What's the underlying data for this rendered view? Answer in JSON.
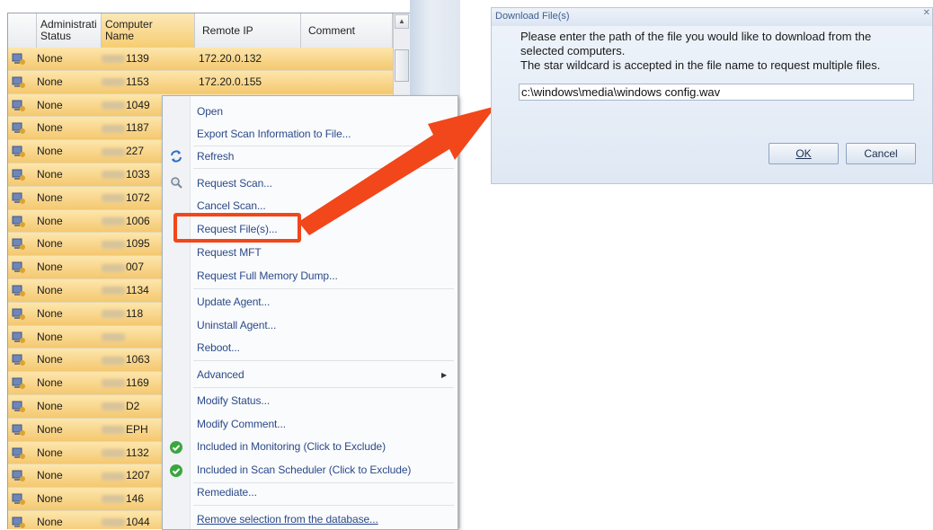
{
  "grid": {
    "headers": {
      "admin_status": "Administrati\nStatus",
      "computer_name": "Computer\nName",
      "remote_ip": "Remote IP",
      "comment": "Comment"
    },
    "rows": [
      {
        "status": "None",
        "name": "1139",
        "ip": "172.20.0.132"
      },
      {
        "status": "None",
        "name": "1153",
        "ip": "172.20.0.155"
      },
      {
        "status": "None",
        "name": "1049",
        "ip": ""
      },
      {
        "status": "None",
        "name": "1187",
        "ip": ""
      },
      {
        "status": "None",
        "name": "227",
        "ip": ""
      },
      {
        "status": "None",
        "name": "1033",
        "ip": ""
      },
      {
        "status": "None",
        "name": "1072",
        "ip": ""
      },
      {
        "status": "None",
        "name": "1006",
        "ip": ""
      },
      {
        "status": "None",
        "name": "1095",
        "ip": ""
      },
      {
        "status": "None",
        "name": "007",
        "ip": ""
      },
      {
        "status": "None",
        "name": "1134",
        "ip": ""
      },
      {
        "status": "None",
        "name": "118",
        "ip": ""
      },
      {
        "status": "None",
        "name": "",
        "ip": ""
      },
      {
        "status": "None",
        "name": "1063",
        "ip": ""
      },
      {
        "status": "None",
        "name": "1169",
        "ip": ""
      },
      {
        "status": "None",
        "name": "D2",
        "ip": ""
      },
      {
        "status": "None",
        "name": "EPH",
        "ip": ""
      },
      {
        "status": "None",
        "name": "1132",
        "ip": ""
      },
      {
        "status": "None",
        "name": "1207",
        "ip": ""
      },
      {
        "status": "None",
        "name": "146",
        "ip": ""
      },
      {
        "status": "None",
        "name": "1044",
        "ip": ""
      }
    ]
  },
  "context_menu": {
    "open": "Open",
    "export": "Export Scan Information to File...",
    "refresh": "Refresh",
    "request_scan": "Request Scan...",
    "cancel_scan": "Cancel Scan...",
    "request_files": "Request File(s)...",
    "request_mft": "Request MFT",
    "request_memory": "Request Full Memory Dump...",
    "update_agent": "Update Agent...",
    "uninstall_agent": "Uninstall Agent...",
    "reboot": "Reboot...",
    "advanced": "Advanced",
    "modify_status": "Modify Status...",
    "modify_comment": "Modify Comment...",
    "included_monitoring": "Included in Monitoring (Click to Exclude)",
    "included_scheduler": "Included in Scan Scheduler (Click to Exclude)",
    "remediate": "Remediate...",
    "remove_selection": "Remove selection from the database..."
  },
  "dialog": {
    "title": "Download File(s)",
    "message_line1": "Please enter the path of the file you would like to download from the",
    "message_line2": "selected computers.",
    "message_line3": "The star wildcard is accepted in the file name to request multiple files.",
    "path_value": "c:\\windows\\media\\windows config.wav",
    "ok_label": "OK",
    "cancel_label": "Cancel"
  },
  "colors": {
    "highlight": "#f2461b",
    "row_selected": "#f6cd73",
    "menu_text": "#2b4a8a"
  },
  "icons": {
    "row_icon": "computer-agent-icon",
    "refresh": "refresh-icon",
    "request_scan": "scan-icon",
    "included": "check-icon"
  }
}
